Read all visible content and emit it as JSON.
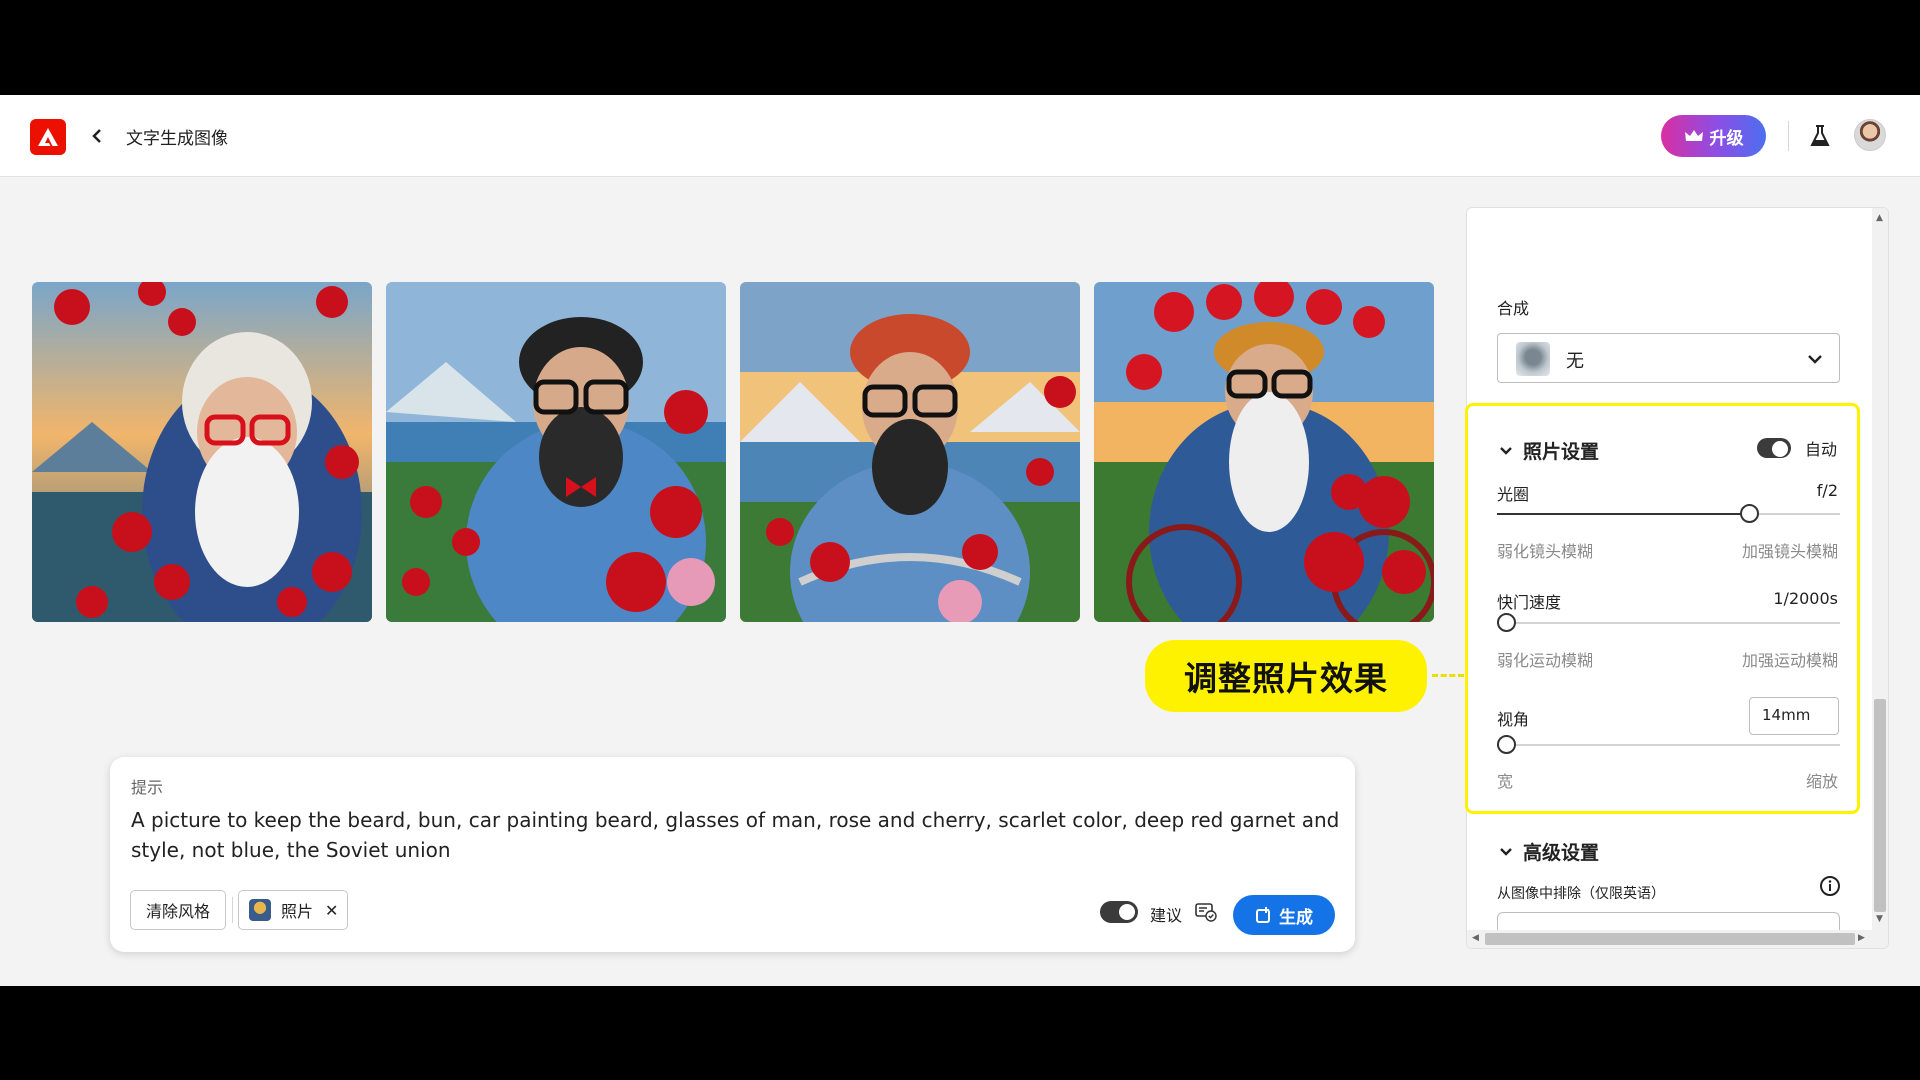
{
  "header": {
    "title": "文字生成图像",
    "upgrade_label": "升级",
    "icons": [
      "adobe-logo",
      "back-chevron-icon",
      "crown-icon",
      "flask-icon",
      "avatar"
    ]
  },
  "images": [
    {
      "name": "generated-image-1",
      "alt": ""
    },
    {
      "name": "generated-image-2",
      "alt": ""
    },
    {
      "name": "generated-image-3",
      "alt": ""
    },
    {
      "name": "generated-image-4",
      "alt": ""
    }
  ],
  "callout": "调整照片效果",
  "prompt": {
    "label": "提示",
    "text": "A picture to keep the beard, bun, car painting beard, glasses of man, rose and cherry, scarlet color, deep red garnet and style, not blue, the Soviet union",
    "clear_style": "清除风格",
    "style_chip": "照片",
    "suggest_label": "建议",
    "generate_label": "生成"
  },
  "panel": {
    "composition_label": "合成",
    "composition_value": "无",
    "photo_settings": {
      "title": "照片设置",
      "auto_label": "自动",
      "aperture_label": "光圈",
      "aperture_value": "f/2",
      "aperture_level": 0.75,
      "aperture_min": "弱化镜头模糊",
      "aperture_max": "加强镜头模糊",
      "shutter_label": "快门速度",
      "shutter_value": "1/2000s",
      "shutter_level": 0,
      "shutter_min": "弱化运动模糊",
      "shutter_max": "加强运动模糊",
      "fov_label": "视角",
      "fov_value": "14mm",
      "fov_level": 0,
      "fov_min": "宽",
      "fov_max": "缩放"
    },
    "advanced": {
      "title": "高级设置",
      "exclude_label": "从图像中排除（仅限英语）"
    }
  },
  "colors": {
    "accent_blue": "#1473e6",
    "highlight_yellow": "#fff200",
    "adobe_red": "#eb1000"
  }
}
